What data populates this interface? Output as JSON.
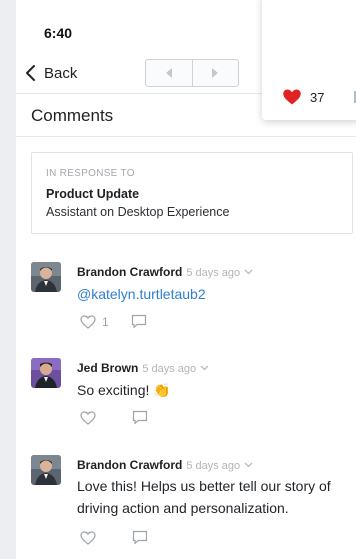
{
  "status": {
    "time": "6:40"
  },
  "nav": {
    "back_label": "Back"
  },
  "header": {
    "title": "Comments"
  },
  "response": {
    "label": "IN RESPONSE TO",
    "title": "Product Update",
    "subtitle": "Assistant on Desktop Experience"
  },
  "comments": [
    {
      "author": "Brandon Crawford",
      "time": "5 days ago",
      "mention": "@katelyn.turtletaub2",
      "text": "",
      "likes": "1"
    },
    {
      "author": "Jed Brown",
      "time": "5 days ago",
      "text": "So exciting!",
      "emoji": "👏",
      "likes": ""
    },
    {
      "author": "Brandon Crawford",
      "time": "5 days ago",
      "text": "Love this! Helps us better tell our story of driving action and personalization.",
      "likes": ""
    }
  ],
  "popover": {
    "heart_count": "37"
  },
  "colors": {
    "accent": "#2f7fd0",
    "heart": "#e02424",
    "muted": "#b0b4b9"
  },
  "icons": [
    "chevron-left-icon",
    "arrow-left-icon",
    "arrow-right-icon",
    "heart-icon",
    "comment-icon",
    "chevron-down-icon",
    "heart-filled-icon",
    "clap-emoji"
  ]
}
